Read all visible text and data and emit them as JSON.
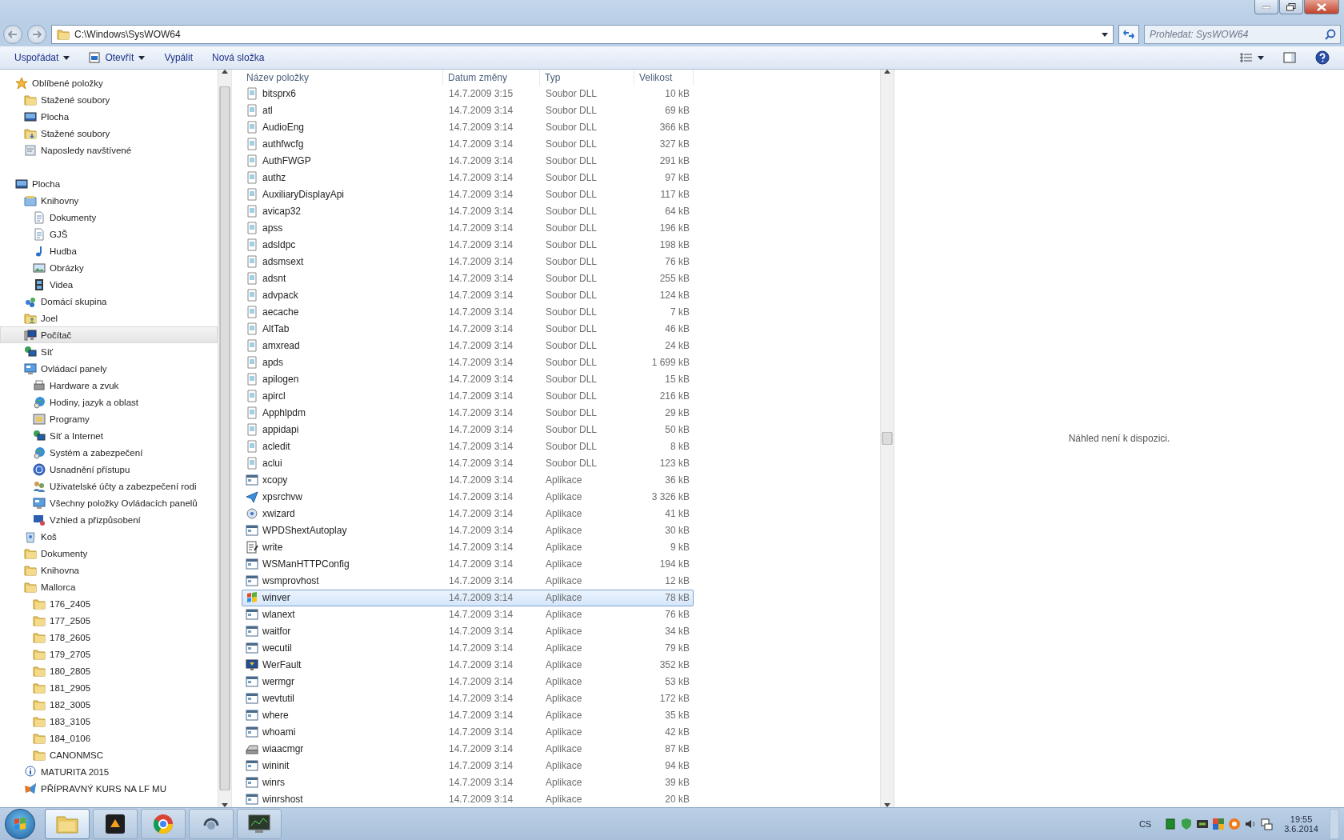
{
  "window": {
    "address": "C:\\Windows\\SysWOW64",
    "search": {
      "placeholder": "Prohledat: SysWOW64"
    }
  },
  "toolbar": [
    {
      "label": "Uspořádat",
      "kind": "menu"
    },
    {
      "label": "Otevřít",
      "kind": "open-menu"
    },
    {
      "label": "Vypálit",
      "kind": "plain"
    },
    {
      "label": "Nová složka",
      "kind": "plain"
    }
  ],
  "sidebar": [
    {
      "label": "Oblíbené položky",
      "kind": "star",
      "selected": false,
      "children": [
        {
          "label": "Stažené soubory",
          "kind": "folder",
          "selected": false
        },
        {
          "label": "Plocha",
          "kind": "desktop",
          "selected": false
        },
        {
          "label": "Stažené soubory",
          "kind": "download",
          "selected": false
        },
        {
          "label": "Naposledy navštívené",
          "kind": "recent",
          "selected": false
        }
      ]
    },
    {
      "label": "Plocha",
      "kind": "desktop",
      "selected": false,
      "children": [
        {
          "label": "Knihovny",
          "kind": "library",
          "selected": false,
          "children": [
            {
              "label": "Dokumenty",
              "kind": "document",
              "selected": false
            },
            {
              "label": "GJŠ",
              "kind": "document",
              "selected": false
            },
            {
              "label": "Hudba",
              "kind": "music",
              "selected": false
            },
            {
              "label": "Obrázky",
              "kind": "picture",
              "selected": false
            },
            {
              "label": "Videa",
              "kind": "video",
              "selected": false
            }
          ]
        },
        {
          "label": "Domácí skupina",
          "kind": "homegroup",
          "selected": false
        },
        {
          "label": "Joel",
          "kind": "user",
          "selected": false
        },
        {
          "label": "Počítač",
          "kind": "computer",
          "selected": true
        },
        {
          "label": "Síť",
          "kind": "network",
          "selected": false
        },
        {
          "label": "Ovládací panely",
          "kind": "panel",
          "selected": false,
          "children": [
            {
              "label": "Hardware a zvuk",
              "kind": "printer",
              "selected": false
            },
            {
              "label": "Hodiny, jazyk a oblast",
              "kind": "globe",
              "selected": false
            },
            {
              "label": "Programy",
              "kind": "programs",
              "selected": false
            },
            {
              "label": "Síť a Internet",
              "kind": "network",
              "selected": false
            },
            {
              "label": "Systém a zabezpečení",
              "kind": "globe",
              "selected": false
            },
            {
              "label": "Usnadnění přístupu",
              "kind": "access",
              "selected": false
            },
            {
              "label": "Uživatelské účty a zabezpečení rodi",
              "kind": "users",
              "selected": false
            },
            {
              "label": "Všechny položky Ovládacích panelů",
              "kind": "panel",
              "selected": false
            },
            {
              "label": "Vzhled a přizpůsobení",
              "kind": "appearance",
              "selected": false
            }
          ]
        },
        {
          "label": "Koš",
          "kind": "bin",
          "selected": false
        },
        {
          "label": "Dokumenty",
          "kind": "folder",
          "selected": false
        },
        {
          "label": "Knihovna",
          "kind": "folder",
          "selected": false
        },
        {
          "label": "Mallorca",
          "kind": "folder",
          "selected": false,
          "children": [
            {
              "label": "176_2405",
              "kind": "folder",
              "selected": false
            },
            {
              "label": "177_2505",
              "kind": "folder",
              "selected": false
            },
            {
              "label": "178_2605",
              "kind": "folder",
              "selected": false
            },
            {
              "label": "179_2705",
              "kind": "folder",
              "selected": false
            },
            {
              "label": "180_2805",
              "kind": "folder",
              "selected": false
            },
            {
              "label": "181_2905",
              "kind": "folder",
              "selected": false
            },
            {
              "label": "182_3005",
              "kind": "folder",
              "selected": false
            },
            {
              "label": "183_3105",
              "kind": "folder",
              "selected": false
            },
            {
              "label": "184_0106",
              "kind": "folder",
              "selected": false
            },
            {
              "label": "CANONMSC",
              "kind": "folder",
              "selected": false
            }
          ]
        },
        {
          "label": "MATURITA 2015",
          "kind": "info",
          "selected": false
        },
        {
          "label": "PŘÍPRAVNÝ KURS NA LF MU",
          "kind": "office",
          "selected": false
        }
      ]
    }
  ],
  "columns": [
    "Název položky",
    "Datum změny",
    "Typ",
    "Velikost"
  ],
  "files": [
    {
      "name": "bitsprx6",
      "date": "14.7.2009 3:15",
      "type": "Soubor DLL",
      "size": "10 kB",
      "kind": "dll",
      "selected": false
    },
    {
      "name": "atl",
      "date": "14.7.2009 3:14",
      "type": "Soubor DLL",
      "size": "69 kB",
      "kind": "dll",
      "selected": false
    },
    {
      "name": "AudioEng",
      "date": "14.7.2009 3:14",
      "type": "Soubor DLL",
      "size": "366 kB",
      "kind": "dll",
      "selected": false
    },
    {
      "name": "authfwcfg",
      "date": "14.7.2009 3:14",
      "type": "Soubor DLL",
      "size": "327 kB",
      "kind": "dll",
      "selected": false
    },
    {
      "name": "AuthFWGP",
      "date": "14.7.2009 3:14",
      "type": "Soubor DLL",
      "size": "291 kB",
      "kind": "dll",
      "selected": false
    },
    {
      "name": "authz",
      "date": "14.7.2009 3:14",
      "type": "Soubor DLL",
      "size": "97 kB",
      "kind": "dll",
      "selected": false
    },
    {
      "name": "AuxiliaryDisplayApi",
      "date": "14.7.2009 3:14",
      "type": "Soubor DLL",
      "size": "117 kB",
      "kind": "dll",
      "selected": false
    },
    {
      "name": "avicap32",
      "date": "14.7.2009 3:14",
      "type": "Soubor DLL",
      "size": "64 kB",
      "kind": "dll",
      "selected": false
    },
    {
      "name": "apss",
      "date": "14.7.2009 3:14",
      "type": "Soubor DLL",
      "size": "196 kB",
      "kind": "dll",
      "selected": false
    },
    {
      "name": "adsldpc",
      "date": "14.7.2009 3:14",
      "type": "Soubor DLL",
      "size": "198 kB",
      "kind": "dll",
      "selected": false
    },
    {
      "name": "adsmsext",
      "date": "14.7.2009 3:14",
      "type": "Soubor DLL",
      "size": "76 kB",
      "kind": "dll",
      "selected": false
    },
    {
      "name": "adsnt",
      "date": "14.7.2009 3:14",
      "type": "Soubor DLL",
      "size": "255 kB",
      "kind": "dll",
      "selected": false
    },
    {
      "name": "advpack",
      "date": "14.7.2009 3:14",
      "type": "Soubor DLL",
      "size": "124 kB",
      "kind": "dll",
      "selected": false
    },
    {
      "name": "aecache",
      "date": "14.7.2009 3:14",
      "type": "Soubor DLL",
      "size": "7 kB",
      "kind": "dll",
      "selected": false
    },
    {
      "name": "AltTab",
      "date": "14.7.2009 3:14",
      "type": "Soubor DLL",
      "size": "46 kB",
      "kind": "dll",
      "selected": false
    },
    {
      "name": "amxread",
      "date": "14.7.2009 3:14",
      "type": "Soubor DLL",
      "size": "24 kB",
      "kind": "dll",
      "selected": false
    },
    {
      "name": "apds",
      "date": "14.7.2009 3:14",
      "type": "Soubor DLL",
      "size": "1 699 kB",
      "kind": "dll",
      "selected": false
    },
    {
      "name": "apilogen",
      "date": "14.7.2009 3:14",
      "type": "Soubor DLL",
      "size": "15 kB",
      "kind": "dll",
      "selected": false
    },
    {
      "name": "apircl",
      "date": "14.7.2009 3:14",
      "type": "Soubor DLL",
      "size": "216 kB",
      "kind": "dll",
      "selected": false
    },
    {
      "name": "Apphlpdm",
      "date": "14.7.2009 3:14",
      "type": "Soubor DLL",
      "size": "29 kB",
      "kind": "dll",
      "selected": false
    },
    {
      "name": "appidapi",
      "date": "14.7.2009 3:14",
      "type": "Soubor DLL",
      "size": "50 kB",
      "kind": "dll",
      "selected": false
    },
    {
      "name": "acledit",
      "date": "14.7.2009 3:14",
      "type": "Soubor DLL",
      "size": "8 kB",
      "kind": "dll",
      "selected": false
    },
    {
      "name": "aclui",
      "date": "14.7.2009 3:14",
      "type": "Soubor DLL",
      "size": "123 kB",
      "kind": "dll",
      "selected": false
    },
    {
      "name": "xcopy",
      "date": "14.7.2009 3:14",
      "type": "Aplikace",
      "size": "36 kB",
      "kind": "app",
      "selected": false
    },
    {
      "name": "xpsrchvw",
      "date": "14.7.2009 3:14",
      "type": "Aplikace",
      "size": "3 326 kB",
      "kind": "plane",
      "selected": false
    },
    {
      "name": "xwizard",
      "date": "14.7.2009 3:14",
      "type": "Aplikace",
      "size": "41 kB",
      "kind": "disc",
      "selected": false
    },
    {
      "name": "WPDShextAutoplay",
      "date": "14.7.2009 3:14",
      "type": "Aplikace",
      "size": "30 kB",
      "kind": "app",
      "selected": false
    },
    {
      "name": "write",
      "date": "14.7.2009 3:14",
      "type": "Aplikace",
      "size": "9 kB",
      "kind": "notepad",
      "selected": false
    },
    {
      "name": "WSManHTTPConfig",
      "date": "14.7.2009 3:14",
      "type": "Aplikace",
      "size": "194 kB",
      "kind": "app",
      "selected": false
    },
    {
      "name": "wsmprovhost",
      "date": "14.7.2009 3:14",
      "type": "Aplikace",
      "size": "12 kB",
      "kind": "app",
      "selected": false
    },
    {
      "name": "winver",
      "date": "14.7.2009 3:14",
      "type": "Aplikace",
      "size": "78 kB",
      "kind": "flag",
      "selected": true
    },
    {
      "name": "wlanext",
      "date": "14.7.2009 3:14",
      "type": "Aplikace",
      "size": "76 kB",
      "kind": "app",
      "selected": false
    },
    {
      "name": "waitfor",
      "date": "14.7.2009 3:14",
      "type": "Aplikace",
      "size": "34 kB",
      "kind": "app",
      "selected": false
    },
    {
      "name": "wecutil",
      "date": "14.7.2009 3:14",
      "type": "Aplikace",
      "size": "79 kB",
      "kind": "app",
      "selected": false
    },
    {
      "name": "WerFault",
      "date": "14.7.2009 3:14",
      "type": "Aplikace",
      "size": "352 kB",
      "kind": "monitor",
      "selected": false
    },
    {
      "name": "wermgr",
      "date": "14.7.2009 3:14",
      "type": "Aplikace",
      "size": "53 kB",
      "kind": "app",
      "selected": false
    },
    {
      "name": "wevtutil",
      "date": "14.7.2009 3:14",
      "type": "Aplikace",
      "size": "172 kB",
      "kind": "app",
      "selected": false
    },
    {
      "name": "where",
      "date": "14.7.2009 3:14",
      "type": "Aplikace",
      "size": "35 kB",
      "kind": "app",
      "selected": false
    },
    {
      "name": "whoami",
      "date": "14.7.2009 3:14",
      "type": "Aplikace",
      "size": "42 kB",
      "kind": "app",
      "selected": false
    },
    {
      "name": "wiaacmgr",
      "date": "14.7.2009 3:14",
      "type": "Aplikace",
      "size": "87 kB",
      "kind": "scanner",
      "selected": false
    },
    {
      "name": "wininit",
      "date": "14.7.2009 3:14",
      "type": "Aplikace",
      "size": "94 kB",
      "kind": "app",
      "selected": false
    },
    {
      "name": "winrs",
      "date": "14.7.2009 3:14",
      "type": "Aplikace",
      "size": "39 kB",
      "kind": "app",
      "selected": false
    },
    {
      "name": "winrshost",
      "date": "14.7.2009 3:14",
      "type": "Aplikace",
      "size": "20 kB",
      "kind": "app",
      "selected": false
    }
  ],
  "preview": "Náhled není k dispozici.",
  "taskbar": {
    "apps": [
      {
        "kind": "explorer",
        "selected": true
      },
      {
        "kind": "cube",
        "selected": false
      },
      {
        "kind": "browser",
        "selected": false
      },
      {
        "kind": "headset",
        "selected": false
      },
      {
        "kind": "monitor",
        "selected": false
      }
    ],
    "language": "CS",
    "time": "19:55",
    "date": "3.6.2014"
  }
}
